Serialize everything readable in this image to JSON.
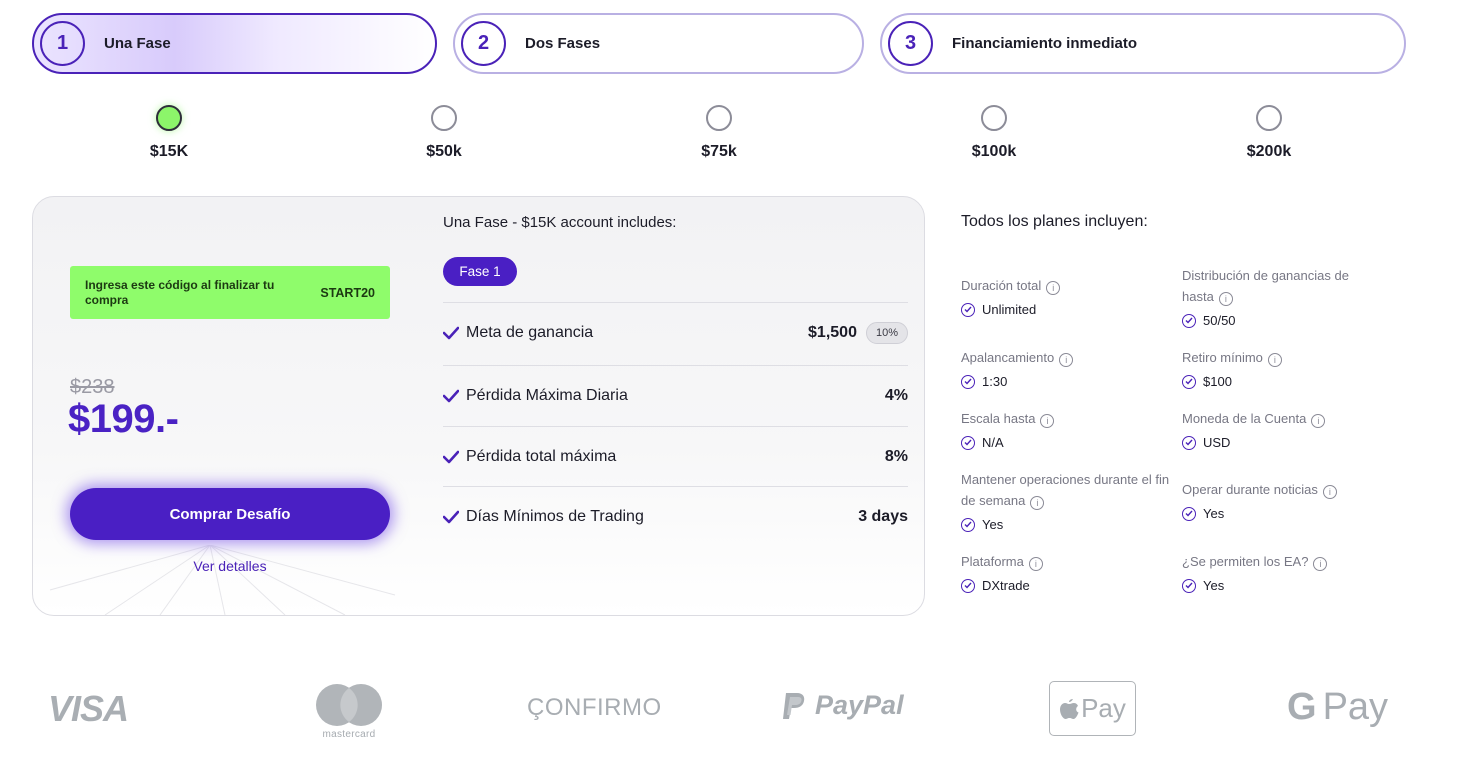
{
  "phases": [
    {
      "num": "1",
      "label": "Una Fase",
      "active": true
    },
    {
      "num": "2",
      "label": "Dos Fases",
      "active": false
    },
    {
      "num": "3",
      "label": "Financiamiento inmediato",
      "active": false
    }
  ],
  "sizes": [
    {
      "label": "$15K",
      "selected": true
    },
    {
      "label": "$50k",
      "selected": false
    },
    {
      "label": "$75k",
      "selected": false
    },
    {
      "label": "$100k",
      "selected": false
    },
    {
      "label": "$200k",
      "selected": false
    }
  ],
  "coupon": {
    "text": "Ingresa este código al finalizar tu compra",
    "code": "START20"
  },
  "pricing": {
    "old_price": "$238",
    "price": "$199.-"
  },
  "buy_button": "Comprar Desafío",
  "details_link": "Ver detalles",
  "includes": {
    "title": "Una Fase - $15K account includes:",
    "phase_badge": "Fase 1",
    "rows": [
      {
        "label": "Meta de ganancia",
        "value": "$1,500",
        "pill": "10%"
      },
      {
        "label": "Pérdida Máxima Diaria",
        "value": "4%"
      },
      {
        "label": "Pérdida total máxima",
        "value": "8%"
      },
      {
        "label": "Días Mínimos de Trading",
        "value": "3 days"
      }
    ]
  },
  "all_plans": {
    "title": "Todos los planes incluyen:",
    "features": [
      {
        "label": "Duración total",
        "value": "Unlimited"
      },
      {
        "label": "Distribución de ganancias de hasta",
        "value": "50/50"
      },
      {
        "label": "Apalancamiento",
        "value": "1:30"
      },
      {
        "label": "Retiro mínimo",
        "value": "$100"
      },
      {
        "label": "Escala hasta",
        "value": "N/A"
      },
      {
        "label": "Moneda de la Cuenta",
        "value": "USD"
      },
      {
        "label": "Mantener operaciones durante el fin de semana",
        "value": "Yes"
      },
      {
        "label": "Operar durante noticias",
        "value": "Yes"
      },
      {
        "label": "Plataforma",
        "value": "DXtrade"
      },
      {
        "label": "¿Se permiten los EA?",
        "value": "Yes"
      }
    ]
  },
  "payments": {
    "visa": "VISA",
    "mastercard": "mastercard",
    "confirmo": "ÇONFIRMO",
    "paypal": "PayPal",
    "applepay": "Pay",
    "gpay": "Pay"
  },
  "colors": {
    "accent": "#4a1fc4",
    "coupon_bg": "#8ffc6b",
    "selected_radio": "#8cf56a"
  }
}
